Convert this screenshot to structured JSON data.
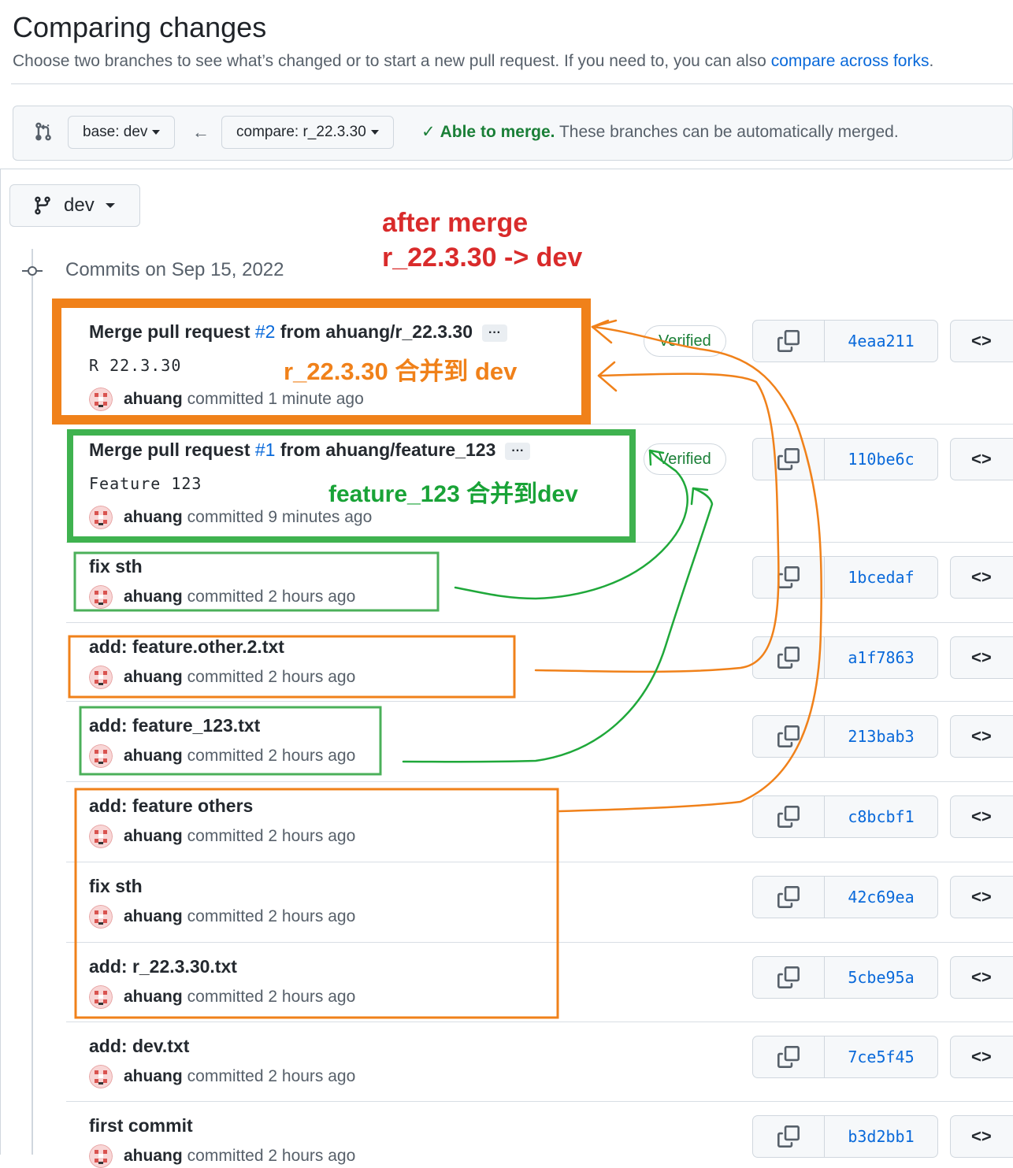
{
  "header": {
    "title": "Comparing changes",
    "subtitle": "Choose two branches to see what’s changed or to start a new pull request. If you need to, you can also",
    "subtitle_link": "compare across forks",
    "subtitle_end": "."
  },
  "range": {
    "base_label": "base: dev",
    "compare_label": "compare: r_22.3.30",
    "arrow": "←",
    "status_strong": "Able to merge.",
    "status_text": "These branches can be automatically merged."
  },
  "branch_select": {
    "label": "dev"
  },
  "timeline": {
    "date_heading": "Commits on Sep 15, 2022"
  },
  "annotations": {
    "line1": "after merge",
    "line2": "r_22.3.30 -> dev",
    "orange_label": "r_22.3.30 合并到 dev",
    "green_label": "feature_123 合并到dev",
    "colors": {
      "red": "#d92b2b",
      "orange": "#f0811a",
      "green": "#19a337"
    }
  },
  "commits": [
    {
      "title_pre": "Merge pull request ",
      "pr_link": "#2",
      "title_post": " from ahuang/r_22.3.30",
      "ellipsis": "···",
      "body": "R 22.3.30",
      "author": "ahuang",
      "action": "committed",
      "time": "1 minute ago",
      "verified": "Verified",
      "sha": "4eaa211"
    },
    {
      "title_pre": "Merge pull request ",
      "pr_link": "#1",
      "title_post": " from ahuang/feature_123",
      "ellipsis": "···",
      "body": "Feature 123",
      "author": "ahuang",
      "action": "committed",
      "time": "9 minutes ago",
      "verified": "Verified",
      "sha": "110be6c"
    },
    {
      "title": "fix sth",
      "author": "ahuang",
      "action": "committed",
      "time": "2 hours ago",
      "sha": "1bcedaf"
    },
    {
      "title": "add: feature.other.2.txt",
      "author": "ahuang",
      "action": "committed",
      "time": "2 hours ago",
      "sha": "a1f7863"
    },
    {
      "title": "add: feature_123.txt",
      "author": "ahuang",
      "action": "committed",
      "time": "2 hours ago",
      "sha": "213bab3"
    },
    {
      "title": "add: feature others",
      "author": "ahuang",
      "action": "committed",
      "time": "2 hours ago",
      "sha": "c8bcbf1"
    },
    {
      "title": "fix sth",
      "author": "ahuang",
      "action": "committed",
      "time": "2 hours ago",
      "sha": "42c69ea"
    },
    {
      "title": "add: r_22.3.30.txt",
      "author": "ahuang",
      "action": "committed",
      "time": "2 hours ago",
      "sha": "5cbe95a"
    },
    {
      "title": "add: dev.txt",
      "author": "ahuang",
      "action": "committed",
      "time": "2 hours ago",
      "sha": "7ce5f45"
    },
    {
      "title": "first commit",
      "author": "ahuang",
      "action": "committed",
      "time": "2 hours ago",
      "sha": "b3d2bb1"
    }
  ],
  "icons": {
    "compare": "compare-arrows-icon",
    "branch": "git-branch-icon",
    "commit_node": "git-commit-icon",
    "copy": "copy-icon",
    "browse": "code-icon",
    "check": "check-icon"
  }
}
